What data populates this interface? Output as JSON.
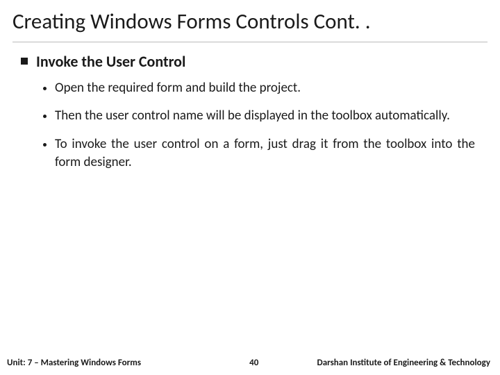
{
  "title": "Creating Windows Forms Controls Cont. .",
  "section_heading": "Invoke the User Control",
  "bullets": [
    "Open the required form and build the project.",
    "Then the user control name will be displayed in the toolbox automatically.",
    "To invoke the user control on a form, just drag it from the toolbox into the form designer."
  ],
  "footer": {
    "unit": "Unit: 7 – Mastering Windows Forms",
    "page": "40",
    "org": "Darshan Institute of Engineering & Technology"
  }
}
